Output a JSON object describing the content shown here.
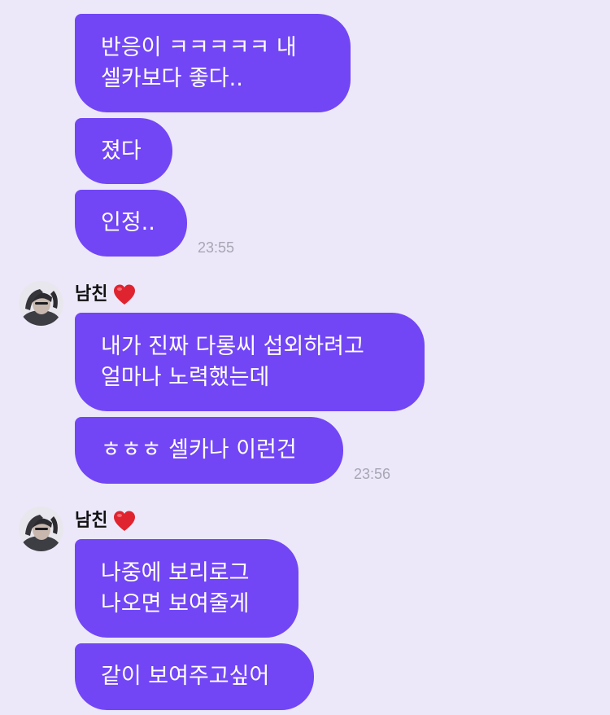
{
  "colors": {
    "background": "#ECE8FA",
    "bubble": "#7246F5",
    "bubble_text": "#FFFFFF",
    "timestamp": "#A8A6B4",
    "heart": "#E0242F"
  },
  "messages_top": [
    {
      "text": "반응이 ㅋㅋㅋㅋㅋ 내\n셀카보다 좋다.."
    },
    {
      "text": "졌다"
    },
    {
      "text": "인정.."
    }
  ],
  "timestamp_1": "23:55",
  "group_2": {
    "sender": "남친",
    "sender_icon": "red-heart-icon",
    "avatar_icon": "profile-photo-avatar",
    "messages": [
      {
        "text": "내가 진짜 다롱씨 섭외하려고\n얼마나 노력했는데"
      },
      {
        "text": "ㅎㅎㅎ 셀카나 이런건"
      }
    ],
    "timestamp": "23:56"
  },
  "group_3": {
    "sender": "남친",
    "sender_icon": "red-heart-icon",
    "avatar_icon": "profile-photo-avatar",
    "messages": [
      {
        "text": "나중에 보리로그\n나오면 보여줄게"
      },
      {
        "text": "같이 보여주고싶어"
      }
    ]
  }
}
